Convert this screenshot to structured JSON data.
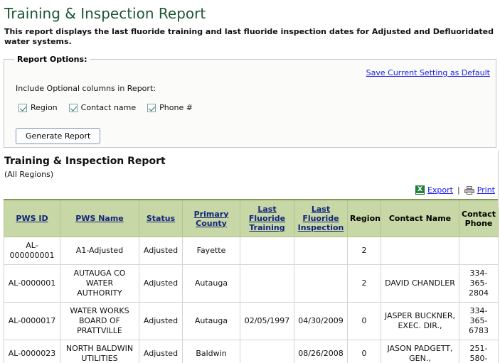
{
  "page": {
    "title": "Training & Inspection Report",
    "intro": "This report displays the last fluoride training and last fluoride inspection dates for Adjusted and Defluoridated water systems."
  },
  "report_options": {
    "legend": "Report Options:",
    "save_default_link": "Save Current Setting as Default",
    "include_label": "Include Optional columns in Report:",
    "checkboxes": [
      {
        "label": "Region",
        "checked": true
      },
      {
        "label": "Contact name",
        "checked": true
      },
      {
        "label": "Phone #",
        "checked": true
      }
    ],
    "generate_button": "Generate Report"
  },
  "report": {
    "title": "Training & Inspection Report",
    "subtitle": "(All Regions)",
    "export_label": "Export",
    "separator": "|",
    "print_label": "Print",
    "export_icon": "excel-icon",
    "print_icon": "printer-icon"
  },
  "table": {
    "columns": [
      {
        "label": "PWS ID",
        "link": true
      },
      {
        "label": "PWS Name",
        "link": true
      },
      {
        "label": "Status",
        "link": true
      },
      {
        "label": "Primary County",
        "link": true
      },
      {
        "label": "Last Fluoride Training",
        "link": true
      },
      {
        "label": "Last Fluoride Inspection",
        "link": true
      },
      {
        "label": "Region",
        "link": false
      },
      {
        "label": "Contact Name",
        "link": false
      },
      {
        "label": "Contact Phone",
        "link": false
      }
    ],
    "rows": [
      {
        "pws_id": "AL-000000001",
        "pws_name": "A1-Adjusted",
        "status": "Adjusted",
        "county": "Fayette",
        "last_training": "",
        "last_inspection": "",
        "region": "2",
        "contact_name": "",
        "contact_phone": ""
      },
      {
        "pws_id": "AL-0000001",
        "pws_name": "AUTAUGA CO WATER AUTHORITY",
        "status": "Adjusted",
        "county": "Autauga",
        "last_training": "",
        "last_inspection": "",
        "region": "2",
        "contact_name": "DAVID CHANDLER",
        "contact_phone": "334-365-2804"
      },
      {
        "pws_id": "AL-0000017",
        "pws_name": "WATER WORKS BOARD OF PRATTVILLE",
        "status": "Adjusted",
        "county": "Autauga",
        "last_training": "02/05/1997",
        "last_inspection": "04/30/2009",
        "region": "0",
        "contact_name": "JASPER BUCKNER, EXEC. DIR.,",
        "contact_phone": "334-365-6783"
      },
      {
        "pws_id": "AL-0000023",
        "pws_name": "NORTH BALDWIN UTILITIES",
        "status": "Adjusted",
        "county": "Baldwin",
        "last_training": "",
        "last_inspection": "08/26/2008",
        "region": "0",
        "contact_name": "JASON PADGETT, GEN.,",
        "contact_phone": "251-580-"
      }
    ]
  },
  "colors": {
    "title_green": "#1d5732",
    "header_bg": "#c8d7a6",
    "header_link": "#11247a",
    "link_blue": "#1a1aee"
  }
}
